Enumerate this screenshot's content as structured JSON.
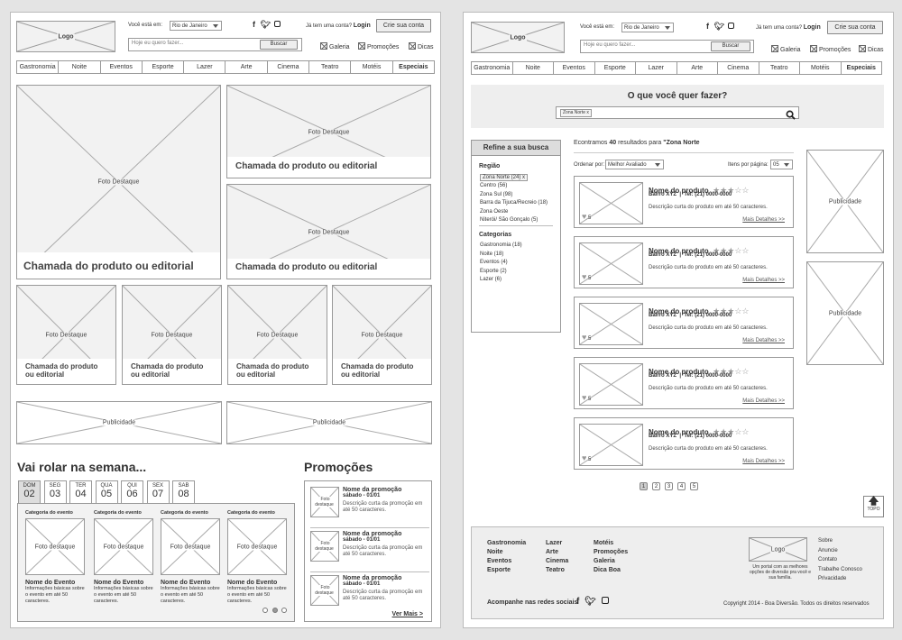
{
  "header": {
    "logo": "Logo",
    "location_label": "Você está em:",
    "location_value": "Rio de Janeiro",
    "search_placeholder": "Hoje eu quero fazer...",
    "search_button": "Buscar",
    "account_q": "Já tem uma conta?",
    "login": "Login",
    "signup": "Crie sua conta",
    "social_icons": [
      "facebook-icon",
      "twitter-icon",
      "instagram-icon"
    ],
    "links": [
      "Galeria",
      "Promoções",
      "Dicas"
    ]
  },
  "nav": [
    "Gastronomia",
    "Noite",
    "Eventos",
    "Esporte",
    "Lazer",
    "Arte",
    "Cinema",
    "Teatro",
    "Motéis",
    "Especiais"
  ],
  "home": {
    "foto_destaque": "Foto Destaque",
    "chamada": "Chamada do produto ou editorial",
    "chamada_small": "Chamada do produto ou editorial",
    "publicidade": "Publicidade",
    "week_title": "Vai rolar na semana...",
    "days": [
      {
        "day": "DOM",
        "num": "02"
      },
      {
        "day": "SEG",
        "num": "03"
      },
      {
        "day": "TER",
        "num": "04"
      },
      {
        "day": "QUA",
        "num": "05"
      },
      {
        "day": "QUI",
        "num": "06"
      },
      {
        "day": "SEX",
        "num": "07"
      },
      {
        "day": "SAB",
        "num": "08"
      }
    ],
    "event": {
      "category": "Categoria do evento",
      "photo": "Foto destaque",
      "name": "Nome do Evento",
      "desc": "Informações básicas sobre o evento em até 50 caracteres."
    },
    "promo_title": "Promoções",
    "promo": {
      "photo": "Foto destaque",
      "name": "Nome da promoção",
      "date": "sábado - 01/01",
      "desc": "Descrição curta da promoção em até 50 caracteres."
    },
    "ver_mais": "Ver Mais >"
  },
  "results": {
    "question": "O que você quer fazer?",
    "search_tag": "Zona Norte",
    "refine_title": "Refine a sua busca",
    "region_title": "Região",
    "regions": [
      "Zona Norte (24)",
      "Centro (56)",
      "Zona Sul (98)",
      "Barra da Tijuca/Recreio (18)",
      "Zona Oeste",
      "Niterói/ São Gonçalo (5)"
    ],
    "categories_title": "Categorias",
    "categories": [
      "Gastronomia (18)",
      "Noite (18)",
      "Eventos (4)",
      "Esporte (2)",
      "Lazer (6)"
    ],
    "found_prefix": "Econtramos",
    "found_count": "40",
    "found_suffix": "resultados para",
    "found_query": "\"Zona Norte",
    "order_label": "Ordenar por:",
    "order_value": "Melhor Avaliado",
    "per_page_label": "Itens por página:",
    "per_page_value": "05",
    "item": {
      "name": "Nome do produto",
      "stars": "★★★☆☆",
      "address": "Bairro XYZ",
      "phone": "Tel: (21) 0000-0000",
      "desc": "Descrição curta do produto em até 50 caracteres.",
      "more": "Mais Detalhes >>",
      "likes": "5"
    },
    "publicidade": "Publicidade",
    "pages": [
      "1",
      "2",
      "3",
      "4",
      "5"
    ],
    "topo": "TOPO"
  },
  "footer": {
    "col1": [
      "Gastronomia",
      "Noite",
      "Eventos",
      "Esporte"
    ],
    "col2": [
      "Lazer",
      "Arte",
      "Cinema",
      "Teatro"
    ],
    "col3": [
      "Motéis",
      "Promoções",
      "Galeria",
      "Dica Boa"
    ],
    "logo": "Logo",
    "tagline": "Um portal com as melhores opções de diversão pra você e sua família.",
    "links": [
      "Sobre",
      "Anuncie",
      "Contato",
      "Trabalhe Conosco",
      "Privacidade"
    ],
    "social_label": "Acompanhe nas redes sociais",
    "copyright": "Copyright 2014 - Boa Diversão. Todos os direitos reservados"
  }
}
